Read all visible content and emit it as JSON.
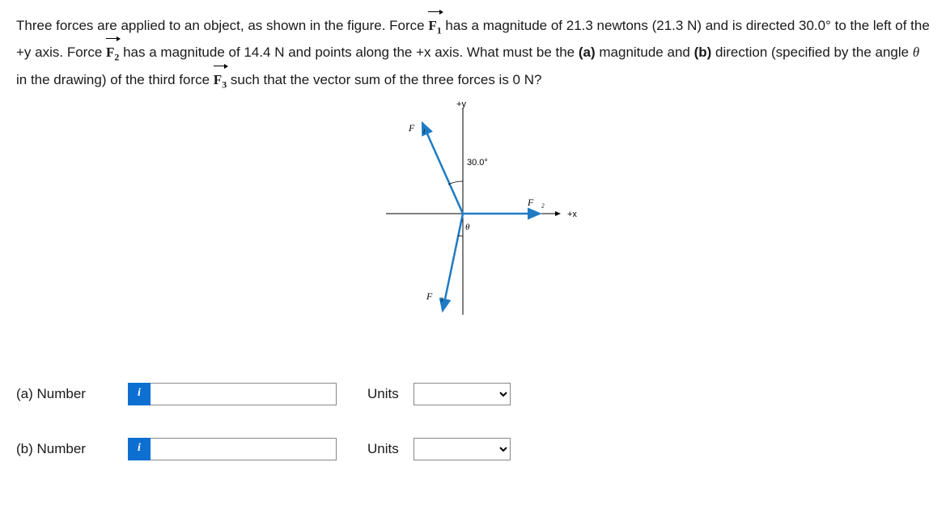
{
  "problem": {
    "p1a": "Three forces are applied to an object, as shown in the figure. Force ",
    "f1": "F",
    "f1sub": "1",
    "p1b": " has a magnitude of 21.3 newtons (21.3 N) and is directed 30.0° to the left of the +y axis. Force ",
    "f2": "F",
    "f2sub": "2",
    "p1c": " has a magnitude of 14.4 N and points along the +x axis. What must be the ",
    "bold_a": "(a)",
    "p1d": " magnitude and ",
    "bold_b": "(b)",
    "p1e": " direction (specified by the angle ",
    "theta": "θ",
    "p1f": " in the drawing) of the third force ",
    "f3": "F",
    "f3sub": "3",
    "p1g": " such that the vector sum of the three forces is 0 N?"
  },
  "figure": {
    "axis_y": "+y",
    "axis_x": "+x",
    "angle_label": "30.0°",
    "theta_label": "θ",
    "F1_label": "F⃗₁",
    "F2_label": "F⃗₂",
    "F3_label": "F⃗₃"
  },
  "answers": {
    "a_label": "(a)   Number",
    "b_label": "(b)   Number",
    "units_label": "Units",
    "info_icon": "i",
    "a_value": "",
    "b_value": ""
  }
}
